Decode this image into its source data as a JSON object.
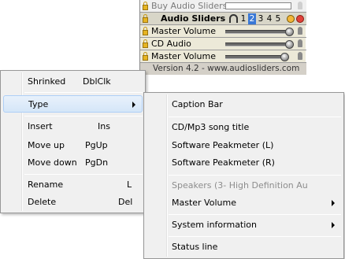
{
  "widget": {
    "title_row": "Buy Audio Sliders",
    "header": {
      "label": "Audio Sliders",
      "tabs": [
        "1",
        "2",
        "3",
        "4",
        "5"
      ],
      "active_tab": "2"
    },
    "channels": [
      {
        "label": "Master Volume",
        "level": 0.97
      },
      {
        "label": "CD Audio",
        "level": 0.97
      },
      {
        "label": "Master Volume",
        "level": 0.9
      }
    ],
    "version": "Version 4.2  -  www.audiosliders.com"
  },
  "context_menu": {
    "items": [
      {
        "label": "Shrinked",
        "shortcut": "DblClk"
      },
      {
        "label": "Type",
        "submenu": true
      },
      {
        "label": "Insert",
        "shortcut": "Ins"
      },
      {
        "label": "Move up",
        "shortcut": "PgUp"
      },
      {
        "label": "Move down",
        "shortcut": "PgDn"
      },
      {
        "label": "Rename",
        "shortcut": "L"
      },
      {
        "label": "Delete",
        "shortcut": "Del"
      }
    ]
  },
  "type_submenu": {
    "items": [
      {
        "label": "Caption Bar"
      },
      {
        "label": "CD/Mp3 song title"
      },
      {
        "label": "Software Peakmeter (L)"
      },
      {
        "label": "Software Peakmeter (R)"
      },
      {
        "label": "Speakers (3- High Definition Au",
        "disabled": true
      },
      {
        "label": "Master Volume",
        "submenu": true
      },
      {
        "label": "System information",
        "submenu": true
      },
      {
        "label": "Status line"
      }
    ]
  },
  "colors": {
    "highlight": "#d5e6f8",
    "menu_bg": "#f0f0f0",
    "active_tab": "#3a78d6",
    "lock": "#e6b422"
  }
}
